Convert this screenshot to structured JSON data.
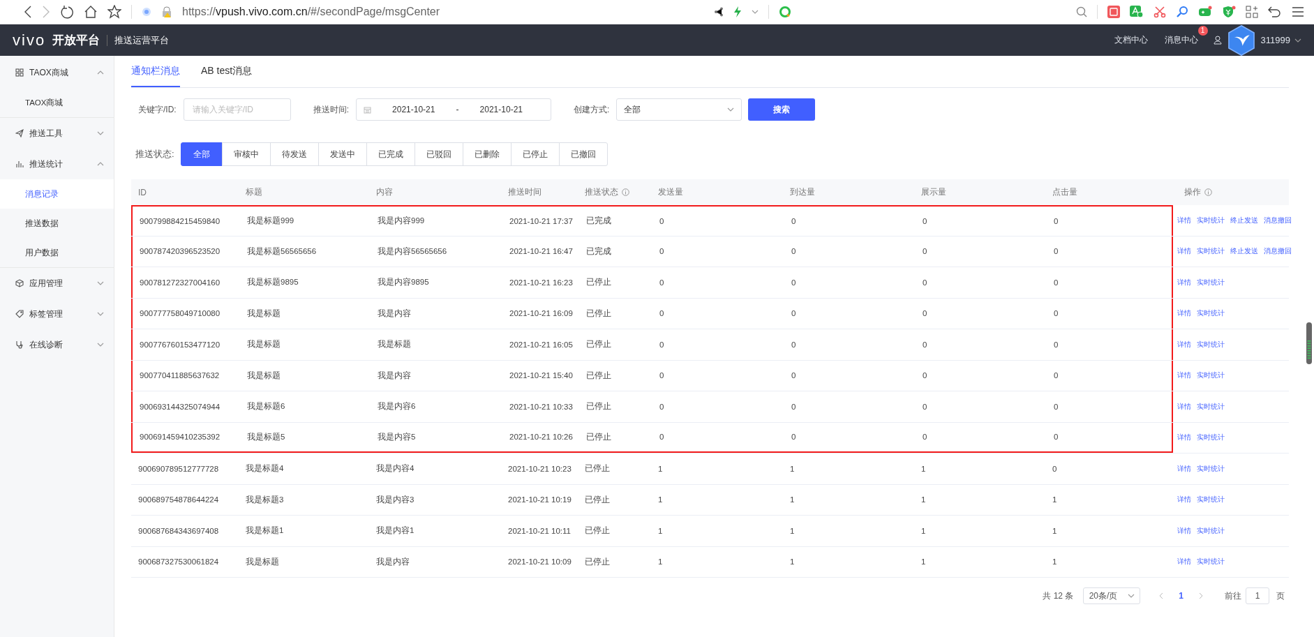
{
  "browser": {
    "url_scheme": "https://",
    "url_domain": "vpush.vivo.com.cn",
    "url_path": "/#/secondPage/msgCenter"
  },
  "header": {
    "logo": "vivo",
    "platform": "开放平台",
    "subtitle": "推送运营平台",
    "links": [
      {
        "label": "文档中心"
      },
      {
        "label": "消息中心",
        "badge": "1"
      }
    ],
    "user": "311999"
  },
  "sidebar": [
    {
      "label": "TAOX商城",
      "expanded": true,
      "children": [
        {
          "label": "TAOX商城",
          "selected": false
        }
      ]
    },
    {
      "label": "推送工具",
      "expanded": false
    },
    {
      "label": "推送统计",
      "expanded": true,
      "children": [
        {
          "label": "消息记录",
          "selected": true
        },
        {
          "label": "推送数据",
          "selected": false
        },
        {
          "label": "用户数据",
          "selected": false
        }
      ]
    },
    {
      "label": "应用管理",
      "expanded": false
    },
    {
      "label": "标签管理",
      "expanded": false
    },
    {
      "label": "在线诊断",
      "expanded": false
    }
  ],
  "tabs": [
    {
      "label": "通知栏消息",
      "selected": true
    },
    {
      "label": "AB test消息",
      "selected": false
    }
  ],
  "filters": {
    "keyword_label": "关键字/ID:",
    "keyword_placeholder": "请输入关键字/ID",
    "time_label": "推送时间:",
    "date_start": "2021-10-21",
    "date_sep": "-",
    "date_end": "2021-10-21",
    "method_label": "创建方式:",
    "method_value": "全部",
    "search_button": "搜索"
  },
  "status_filter": {
    "label": "推送状态:",
    "options": [
      {
        "label": "全部",
        "selected": true
      },
      {
        "label": "审核中",
        "selected": false
      },
      {
        "label": "待发送",
        "selected": false
      },
      {
        "label": "发送中",
        "selected": false
      },
      {
        "label": "已完成",
        "selected": false
      },
      {
        "label": "已驳回",
        "selected": false
      },
      {
        "label": "已删除",
        "selected": false
      },
      {
        "label": "已停止",
        "selected": false
      },
      {
        "label": "已撤回",
        "selected": false
      }
    ]
  },
  "table": {
    "columns": [
      {
        "label": "ID",
        "info": false
      },
      {
        "label": "标题",
        "info": false
      },
      {
        "label": "内容",
        "info": false
      },
      {
        "label": "推送时间",
        "info": false
      },
      {
        "label": "推送状态",
        "info": true
      },
      {
        "label": "发送量",
        "info": false
      },
      {
        "label": "到达量",
        "info": false
      },
      {
        "label": "展示量",
        "info": false
      },
      {
        "label": "点击量",
        "info": false
      },
      {
        "label": "操作",
        "info": true
      }
    ],
    "rows": [
      {
        "cells": [
          "900799884215459840",
          "我是标题999",
          "我是内容999",
          "2021-10-21 17:37",
          "已完成",
          "0",
          "0",
          "0",
          "0"
        ],
        "actions": [
          "详情",
          "实时统计",
          "终止发送",
          "消息撤回"
        ],
        "highlighted": true
      },
      {
        "cells": [
          "900787420396523520",
          "我是标题56565656",
          "我是内容56565656",
          "2021-10-21 16:47",
          "已完成",
          "0",
          "0",
          "0",
          "0"
        ],
        "actions": [
          "详情",
          "实时统计",
          "终止发送",
          "消息撤回"
        ],
        "highlighted": true
      },
      {
        "cells": [
          "900781272327004160",
          "我是标题9895",
          "我是内容9895",
          "2021-10-21 16:23",
          "已停止",
          "0",
          "0",
          "0",
          "0"
        ],
        "actions": [
          "详情",
          "实时统计"
        ],
        "highlighted": true
      },
      {
        "cells": [
          "900777758049710080",
          "我是标题",
          "我是内容",
          "2021-10-21 16:09",
          "已停止",
          "0",
          "0",
          "0",
          "0"
        ],
        "actions": [
          "详情",
          "实时统计"
        ],
        "highlighted": true
      },
      {
        "cells": [
          "900776760153477120",
          "我是标题",
          "我是标题",
          "2021-10-21 16:05",
          "已停止",
          "0",
          "0",
          "0",
          "0"
        ],
        "actions": [
          "详情",
          "实时统计"
        ],
        "highlighted": true
      },
      {
        "cells": [
          "900770411885637632",
          "我是标题",
          "我是内容",
          "2021-10-21 15:40",
          "已停止",
          "0",
          "0",
          "0",
          "0"
        ],
        "actions": [
          "详情",
          "实时统计"
        ],
        "highlighted": true
      },
      {
        "cells": [
          "900693144325074944",
          "我是标题6",
          "我是内容6",
          "2021-10-21 10:33",
          "已停止",
          "0",
          "0",
          "0",
          "0"
        ],
        "actions": [
          "详情",
          "实时统计"
        ],
        "highlighted": true
      },
      {
        "cells": [
          "900691459410235392",
          "我是标题5",
          "我是内容5",
          "2021-10-21 10:26",
          "已停止",
          "0",
          "0",
          "0",
          "0"
        ],
        "actions": [
          "详情",
          "实时统计"
        ],
        "highlighted": true
      },
      {
        "cells": [
          "900690789512777728",
          "我是标题4",
          "我是内容4",
          "2021-10-21 10:23",
          "已停止",
          "1",
          "1",
          "1",
          "0"
        ],
        "actions": [
          "详情",
          "实时统计"
        ],
        "highlighted": false
      },
      {
        "cells": [
          "900689754878644224",
          "我是标题3",
          "我是内容3",
          "2021-10-21 10:19",
          "已停止",
          "1",
          "1",
          "1",
          "1"
        ],
        "actions": [
          "详情",
          "实时统计"
        ],
        "highlighted": false
      },
      {
        "cells": [
          "900687684343697408",
          "我是标题1",
          "我是内容1",
          "2021-10-21 10:11",
          "已停止",
          "1",
          "1",
          "1",
          "1"
        ],
        "actions": [
          "详情",
          "实时统计"
        ],
        "highlighted": false
      },
      {
        "cells": [
          "900687327530061824",
          "我是标题",
          "我是内容",
          "2021-10-21 10:09",
          "已停止",
          "1",
          "1",
          "1",
          "1"
        ],
        "actions": [
          "详情",
          "实时统计"
        ],
        "highlighted": false
      }
    ]
  },
  "pagination": {
    "total": "共 12 条",
    "page_size": "20条/页",
    "pages": [
      {
        "label": "1",
        "selected": true
      }
    ],
    "goto_label": "前往",
    "goto_value": "1",
    "goto_suffix": "页"
  }
}
